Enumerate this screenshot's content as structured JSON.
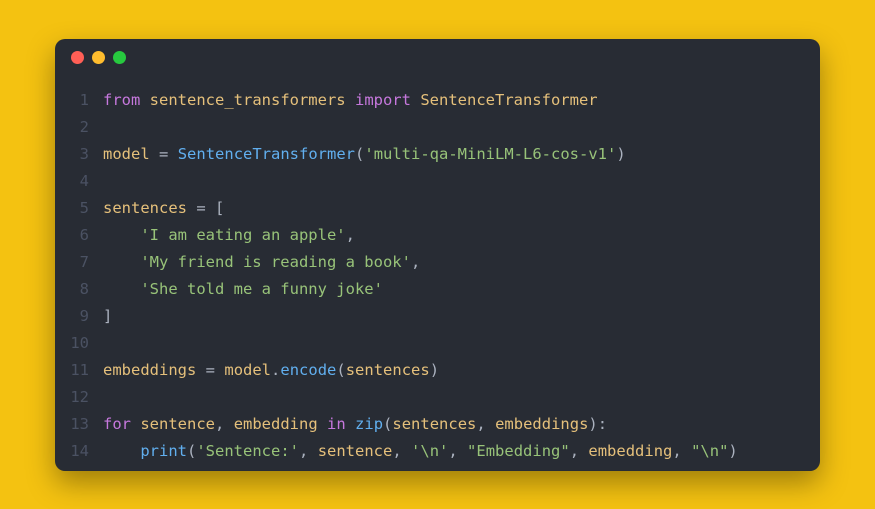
{
  "window": {
    "dots": [
      "red",
      "yellow",
      "green"
    ]
  },
  "code": {
    "lines": [
      {
        "n": "1",
        "tokens": [
          [
            "kw",
            "from"
          ],
          [
            "d",
            " "
          ],
          [
            "id",
            "sentence_transformers"
          ],
          [
            "d",
            " "
          ],
          [
            "kw",
            "import"
          ],
          [
            "d",
            " "
          ],
          [
            "id",
            "SentenceTransformer"
          ]
        ]
      },
      {
        "n": "2",
        "tokens": []
      },
      {
        "n": "3",
        "tokens": [
          [
            "id",
            "model"
          ],
          [
            "d",
            " "
          ],
          [
            "p",
            "="
          ],
          [
            "d",
            " "
          ],
          [
            "cls",
            "SentenceTransformer"
          ],
          [
            "p",
            "("
          ],
          [
            "str",
            "'multi-qa-MiniLM-L6-cos-v1'"
          ],
          [
            "p",
            ")"
          ]
        ]
      },
      {
        "n": "4",
        "tokens": []
      },
      {
        "n": "5",
        "tokens": [
          [
            "id",
            "sentences"
          ],
          [
            "d",
            " "
          ],
          [
            "p",
            "="
          ],
          [
            "d",
            " "
          ],
          [
            "p",
            "["
          ]
        ]
      },
      {
        "n": "6",
        "tokens": [
          [
            "d",
            "    "
          ],
          [
            "str",
            "'I am eating an apple'"
          ],
          [
            "p",
            ","
          ]
        ]
      },
      {
        "n": "7",
        "tokens": [
          [
            "d",
            "    "
          ],
          [
            "str",
            "'My friend is reading a book'"
          ],
          [
            "p",
            ","
          ]
        ]
      },
      {
        "n": "8",
        "tokens": [
          [
            "d",
            "    "
          ],
          [
            "str",
            "'She told me a funny joke'"
          ]
        ]
      },
      {
        "n": "9",
        "tokens": [
          [
            "p",
            "]"
          ]
        ]
      },
      {
        "n": "10",
        "tokens": []
      },
      {
        "n": "11",
        "tokens": [
          [
            "id",
            "embeddings"
          ],
          [
            "d",
            " "
          ],
          [
            "p",
            "="
          ],
          [
            "d",
            " "
          ],
          [
            "id",
            "model"
          ],
          [
            "p",
            "."
          ],
          [
            "fn",
            "encode"
          ],
          [
            "p",
            "("
          ],
          [
            "id",
            "sentences"
          ],
          [
            "p",
            ")"
          ]
        ]
      },
      {
        "n": "12",
        "tokens": []
      },
      {
        "n": "13",
        "tokens": [
          [
            "kw",
            "for"
          ],
          [
            "d",
            " "
          ],
          [
            "id",
            "sentence"
          ],
          [
            "p",
            ","
          ],
          [
            "d",
            " "
          ],
          [
            "id",
            "embedding"
          ],
          [
            "d",
            " "
          ],
          [
            "kw",
            "in"
          ],
          [
            "d",
            " "
          ],
          [
            "fn",
            "zip"
          ],
          [
            "p",
            "("
          ],
          [
            "id",
            "sentences"
          ],
          [
            "p",
            ","
          ],
          [
            "d",
            " "
          ],
          [
            "id",
            "embeddings"
          ],
          [
            "p",
            "):"
          ]
        ]
      },
      {
        "n": "14",
        "tokens": [
          [
            "d",
            "    "
          ],
          [
            "fn",
            "print"
          ],
          [
            "p",
            "("
          ],
          [
            "str",
            "'Sentence:'"
          ],
          [
            "p",
            ","
          ],
          [
            "d",
            " "
          ],
          [
            "id",
            "sentence"
          ],
          [
            "p",
            ","
          ],
          [
            "d",
            " "
          ],
          [
            "str",
            "'\\n'"
          ],
          [
            "p",
            ","
          ],
          [
            "d",
            " "
          ],
          [
            "str",
            "\"Embedding\""
          ],
          [
            "p",
            ","
          ],
          [
            "d",
            " "
          ],
          [
            "id",
            "embedding"
          ],
          [
            "p",
            ","
          ],
          [
            "d",
            " "
          ],
          [
            "str",
            "\"\\n\""
          ],
          [
            "p",
            ")"
          ]
        ]
      }
    ]
  }
}
